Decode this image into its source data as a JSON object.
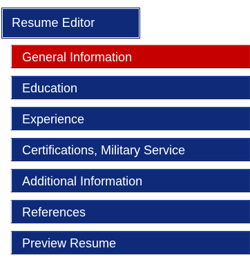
{
  "header": {
    "title": "Resume Editor"
  },
  "menu": {
    "items": [
      {
        "label": "General Information",
        "active": true
      },
      {
        "label": "Education",
        "active": false
      },
      {
        "label": "Experience",
        "active": false
      },
      {
        "label": "Certifications, Military Service",
        "active": false
      },
      {
        "label": "Additional Information",
        "active": false
      },
      {
        "label": "References",
        "active": false
      },
      {
        "label": "Preview Resume",
        "active": false
      }
    ]
  },
  "colors": {
    "nav_blue": "#0e2a78",
    "active_red": "#c60000",
    "text": "#ffffff"
  }
}
